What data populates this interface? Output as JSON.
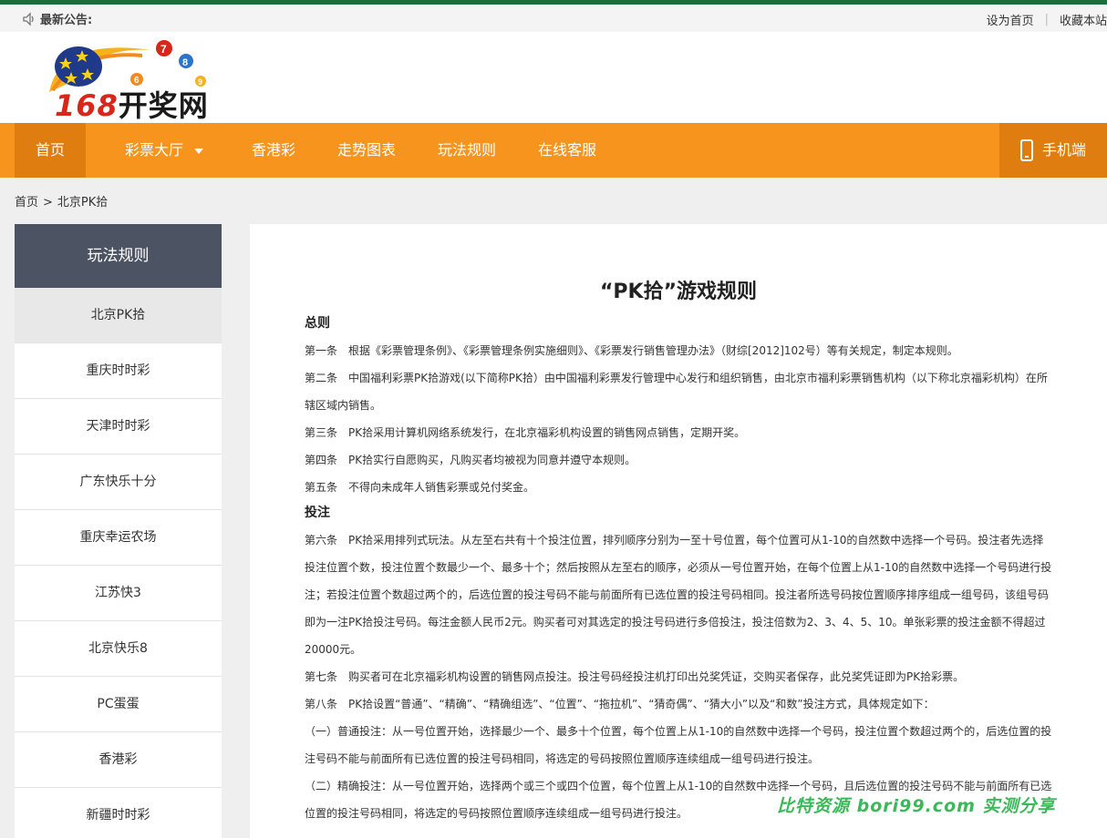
{
  "notice": {
    "label": "最新公告:",
    "set_home": "设为首页",
    "bookmark": "收藏本站"
  },
  "logo": {
    "number": "168",
    "name": "开奖网"
  },
  "nav": {
    "home": "首页",
    "lottery_hall": "彩票大厅",
    "hk": "香港彩",
    "trend": "走势图表",
    "rules": "玩法规则",
    "service": "在线客服",
    "mobile": "手机端"
  },
  "breadcrumb": {
    "home": "首页",
    "sep": ">",
    "current": "北京PK拾"
  },
  "sidebar": {
    "title": "玩法规则",
    "items": [
      {
        "label": "北京PK拾"
      },
      {
        "label": "重庆时时彩"
      },
      {
        "label": "天津时时彩"
      },
      {
        "label": "广东快乐十分"
      },
      {
        "label": "重庆幸运农场"
      },
      {
        "label": "江苏快3"
      },
      {
        "label": "北京快乐8"
      },
      {
        "label": "PC蛋蛋"
      },
      {
        "label": "香港彩"
      },
      {
        "label": "新疆时时彩"
      }
    ]
  },
  "article": {
    "title": "“PK拾”游戏规则",
    "section1": "总则",
    "p1": "第一条　根据《彩票管理条例》、《彩票管理条例实施细则》、《彩票发行销售管理办法》（财综[2012]102号）等有关规定，制定本规则。",
    "p2": "第二条　中国福利彩票PK拾游戏(以下简称PK拾）由中国福利彩票发行管理中心发行和组织销售，由北京市福利彩票销售机构（以下称北京福彩机构）在所辖区域内销售。",
    "p3": "第三条　PK拾采用计算机网络系统发行，在北京福彩机构设置的销售网点销售，定期开奖。",
    "p4": "第四条　PK拾实行自愿购买，凡购买者均被视为同意并遵守本规则。",
    "p5": "第五条　不得向未成年人销售彩票或兑付奖金。",
    "section2": "投注",
    "p6": "第六条　PK拾采用排列式玩法。从左至右共有十个投注位置，排列顺序分别为一至十号位置，每个位置可从1-10的自然数中选择一个号码。投注者先选择投注位置个数，投注位置个数最少一个、最多十个；然后按照从左至右的顺序，必须从一号位置开始，在每个位置上从1-10的自然数中选择一个号码进行投注；若投注位置个数超过两个的，后选位置的投注号码不能与前面所有已选位置的投注号码相同。投注者所选号码按位置顺序排序组成一组号码，该组号码即为一注PK拾投注号码。每注金额人民币2元。购买者可对其选定的投注号码进行多倍投注，投注倍数为2、3、4、5、10。单张彩票的投注金额不得超过20000元。",
    "p7": "第七条　购买者可在北京福彩机构设置的销售网点投注。投注号码经投注机打印出兑奖凭证，交购买者保存，此兑奖凭证即为PK拾彩票。",
    "p8": "第八条　PK拾设置“普通”、“精确”、“精确组选”、“位置”、“拖拉机”、“猜奇偶”、“猜大小”以及“和数”投注方式，具体规定如下：",
    "p9": "（一）普通投注：从一号位置开始，选择最少一个、最多十个位置，每个位置上从1-10的自然数中选择一个号码，投注位置个数超过两个的，后选位置的投注号码不能与前面所有已选位置的投注号码相同，将选定的号码按照位置顺序连续组成一组号码进行投注。",
    "p10": "（二）精确投注：从一号位置开始，选择两个或三个或四个位置，每个位置上从1-10的自然数中选择一个号码，且后选位置的投注号码不能与前面所有已选位置的投注号码相同，将选定的号码按照位置顺序连续组成一组号码进行投注。"
  },
  "watermark": "比特资源 bori99.com 实测分享"
}
